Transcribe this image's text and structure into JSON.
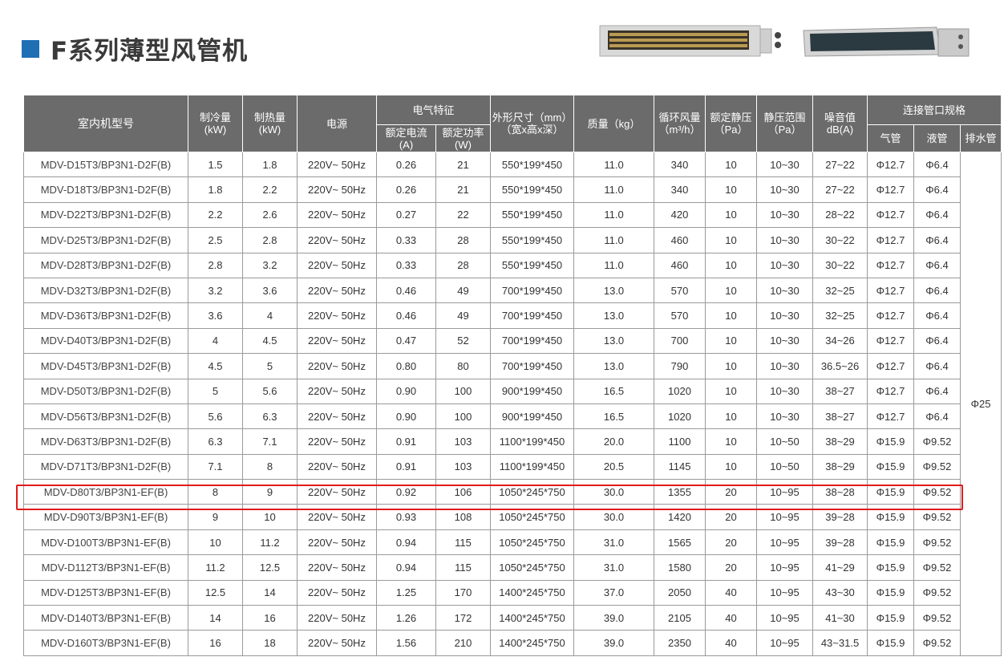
{
  "page": {
    "title": "F系列薄型风管机"
  },
  "table": {
    "headers": {
      "model": "室内机型号",
      "cooling": "制冷量\n(kW)",
      "heating": "制热量\n(kW)",
      "power_supply": "电源",
      "electrical": "电气特征",
      "rated_current": "额定电流\n(A)",
      "rated_power": "额定功率\n(W)",
      "dimensions": "外形尺寸（mm）\n（宽x高x深）",
      "weight": "质量（kg）",
      "airflow": "循环风量\n（m³/h）",
      "static_pressure": "额定静压\n（Pa）",
      "pressure_range": "静压范围\n（Pa）",
      "noise": "噪音值\ndB(A)",
      "pipe_spec": "连接管口规格",
      "gas_pipe": "气管",
      "liquid_pipe": "液管",
      "drain_pipe": "排水管"
    },
    "drain_value": "Φ25",
    "rows": [
      [
        "MDV-D15T3/BP3N1-D2F(B)",
        "1.5",
        "1.8",
        "220V~ 50Hz",
        "0.26",
        "21",
        "550*199*450",
        "11.0",
        "340",
        "10",
        "10~30",
        "27~22",
        "Φ12.7",
        "Φ6.4"
      ],
      [
        "MDV-D18T3/BP3N1-D2F(B)",
        "1.8",
        "2.2",
        "220V~ 50Hz",
        "0.26",
        "21",
        "550*199*450",
        "11.0",
        "340",
        "10",
        "10~30",
        "27~22",
        "Φ12.7",
        "Φ6.4"
      ],
      [
        "MDV-D22T3/BP3N1-D2F(B)",
        "2.2",
        "2.6",
        "220V~ 50Hz",
        "0.27",
        "22",
        "550*199*450",
        "11.0",
        "420",
        "10",
        "10~30",
        "28~22",
        "Φ12.7",
        "Φ6.4"
      ],
      [
        "MDV-D25T3/BP3N1-D2F(B)",
        "2.5",
        "2.8",
        "220V~ 50Hz",
        "0.33",
        "28",
        "550*199*450",
        "11.0",
        "460",
        "10",
        "10~30",
        "30~22",
        "Φ12.7",
        "Φ6.4"
      ],
      [
        "MDV-D28T3/BP3N1-D2F(B)",
        "2.8",
        "3.2",
        "220V~ 50Hz",
        "0.33",
        "28",
        "550*199*450",
        "11.0",
        "460",
        "10",
        "10~30",
        "30~22",
        "Φ12.7",
        "Φ6.4"
      ],
      [
        "MDV-D32T3/BP3N1-D2F(B)",
        "3.2",
        "3.6",
        "220V~ 50Hz",
        "0.46",
        "49",
        "700*199*450",
        "13.0",
        "570",
        "10",
        "10~30",
        "32~25",
        "Φ12.7",
        "Φ6.4"
      ],
      [
        "MDV-D36T3/BP3N1-D2F(B)",
        "3.6",
        "4",
        "220V~ 50Hz",
        "0.46",
        "49",
        "700*199*450",
        "13.0",
        "570",
        "10",
        "10~30",
        "32~25",
        "Φ12.7",
        "Φ6.4"
      ],
      [
        "MDV-D40T3/BP3N1-D2F(B)",
        "4",
        "4.5",
        "220V~ 50Hz",
        "0.47",
        "52",
        "700*199*450",
        "13.0",
        "700",
        "10",
        "10~30",
        "34~26",
        "Φ12.7",
        "Φ6.4"
      ],
      [
        "MDV-D45T3/BP3N1-D2F(B)",
        "4.5",
        "5",
        "220V~ 50Hz",
        "0.80",
        "80",
        "700*199*450",
        "13.0",
        "790",
        "10",
        "10~30",
        "36.5~26",
        "Φ12.7",
        "Φ6.4"
      ],
      [
        "MDV-D50T3/BP3N1-D2F(B)",
        "5",
        "5.6",
        "220V~ 50Hz",
        "0.90",
        "100",
        "900*199*450",
        "16.5",
        "1020",
        "10",
        "10~30",
        "38~27",
        "Φ12.7",
        "Φ6.4"
      ],
      [
        "MDV-D56T3/BP3N1-D2F(B)",
        "5.6",
        "6.3",
        "220V~ 50Hz",
        "0.90",
        "100",
        "900*199*450",
        "16.5",
        "1020",
        "10",
        "10~30",
        "38~27",
        "Φ12.7",
        "Φ6.4"
      ],
      [
        "MDV-D63T3/BP3N1-D2F(B)",
        "6.3",
        "7.1",
        "220V~ 50Hz",
        "0.91",
        "103",
        "1100*199*450",
        "20.0",
        "1100",
        "10",
        "10~50",
        "38~29",
        "Φ15.9",
        "Φ9.52"
      ],
      [
        "MDV-D71T3/BP3N1-D2F(B)",
        "7.1",
        "8",
        "220V~ 50Hz",
        "0.91",
        "103",
        "1100*199*450",
        "20.5",
        "1145",
        "10",
        "10~50",
        "38~29",
        "Φ15.9",
        "Φ9.52"
      ],
      [
        "MDV-D80T3/BP3N1-EF(B)",
        "8",
        "9",
        "220V~ 50Hz",
        "0.92",
        "106",
        "1050*245*750",
        "30.0",
        "1355",
        "20",
        "10~95",
        "38~28",
        "Φ15.9",
        "Φ9.52"
      ],
      [
        "MDV-D90T3/BP3N1-EF(B)",
        "9",
        "10",
        "220V~ 50Hz",
        "0.93",
        "108",
        "1050*245*750",
        "30.0",
        "1420",
        "20",
        "10~95",
        "39~28",
        "Φ15.9",
        "Φ9.52"
      ],
      [
        "MDV-D100T3/BP3N1-EF(B)",
        "10",
        "11.2",
        "220V~ 50Hz",
        "0.94",
        "115",
        "1050*245*750",
        "31.0",
        "1565",
        "20",
        "10~95",
        "39~28",
        "Φ15.9",
        "Φ9.52"
      ],
      [
        "MDV-D112T3/BP3N1-EF(B)",
        "11.2",
        "12.5",
        "220V~ 50Hz",
        "0.94",
        "115",
        "1050*245*750",
        "31.0",
        "1580",
        "20",
        "10~95",
        "41~29",
        "Φ15.9",
        "Φ9.52"
      ],
      [
        "MDV-D125T3/BP3N1-EF(B)",
        "12.5",
        "14",
        "220V~ 50Hz",
        "1.25",
        "170",
        "1400*245*750",
        "37.0",
        "2050",
        "40",
        "10~95",
        "43~30",
        "Φ15.9",
        "Φ9.52"
      ],
      [
        "MDV-D140T3/BP3N1-EF(B)",
        "14",
        "16",
        "220V~ 50Hz",
        "1.26",
        "172",
        "1400*245*750",
        "39.0",
        "2105",
        "40",
        "10~95",
        "41~30",
        "Φ15.9",
        "Φ9.52"
      ],
      [
        "MDV-D160T3/BP3N1-EF(B)",
        "16",
        "18",
        "220V~ 50Hz",
        "1.56",
        "210",
        "1400*245*750",
        "39.0",
        "2350",
        "40",
        "10~95",
        "43~31.5",
        "Φ15.9",
        "Φ9.52"
      ]
    ],
    "highlighted_model": "MDV-D80T3/BP3N1-EF(B)"
  },
  "colors": {
    "accent": "#1f6fb5",
    "header_bg": "#6b6b6b",
    "highlight": "#e11b1b"
  }
}
